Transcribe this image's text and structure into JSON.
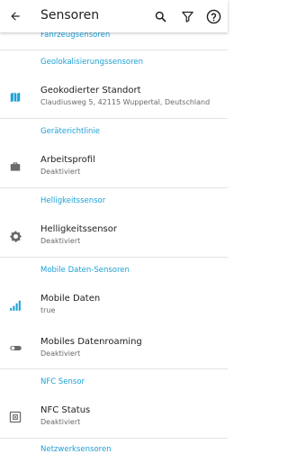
{
  "appbar": {
    "title": "Sensoren",
    "back_icon": "arrow-back-icon",
    "search_icon": "search-icon",
    "filter_icon": "filter-icon",
    "help_icon": "help-icon"
  },
  "colors": {
    "accent": "#1da1d6",
    "icon": "#6b6b6b",
    "signal": "#1da1d6"
  },
  "sections": {
    "fahrzeug": "Fahrzeugsensoren",
    "geo": "Geolokalisierungssensoren",
    "richtung": "Geräterichtlinie",
    "hell": "Helligkeitssensor",
    "mobil": "Mobile Daten-Sensoren",
    "nfc": "NFC Sensor",
    "netz": "Netzwerksensoren"
  },
  "items": {
    "standort": {
      "label": "Geokodierter Standort",
      "value": "Claudiusweg 5, 42115 Wuppertal, Deutschland",
      "icon": "map-icon"
    },
    "arbeitsprofil": {
      "label": "Arbeitsprofil",
      "value": "Deaktiviert",
      "icon": "briefcase-icon"
    },
    "helligkeit": {
      "label": "Helligkeitssensor",
      "value": "Deaktiviert",
      "icon": "brightness-icon"
    },
    "mobile_daten": {
      "label": "Mobile Daten",
      "value": "true",
      "icon": "signal-icon"
    },
    "roaming": {
      "label": "Mobiles Datenroaming",
      "value": "Deaktiviert",
      "icon": "toggle-icon"
    },
    "nfc": {
      "label": "NFC Status",
      "value": "Deaktiviert",
      "icon": "nfc-icon"
    }
  }
}
